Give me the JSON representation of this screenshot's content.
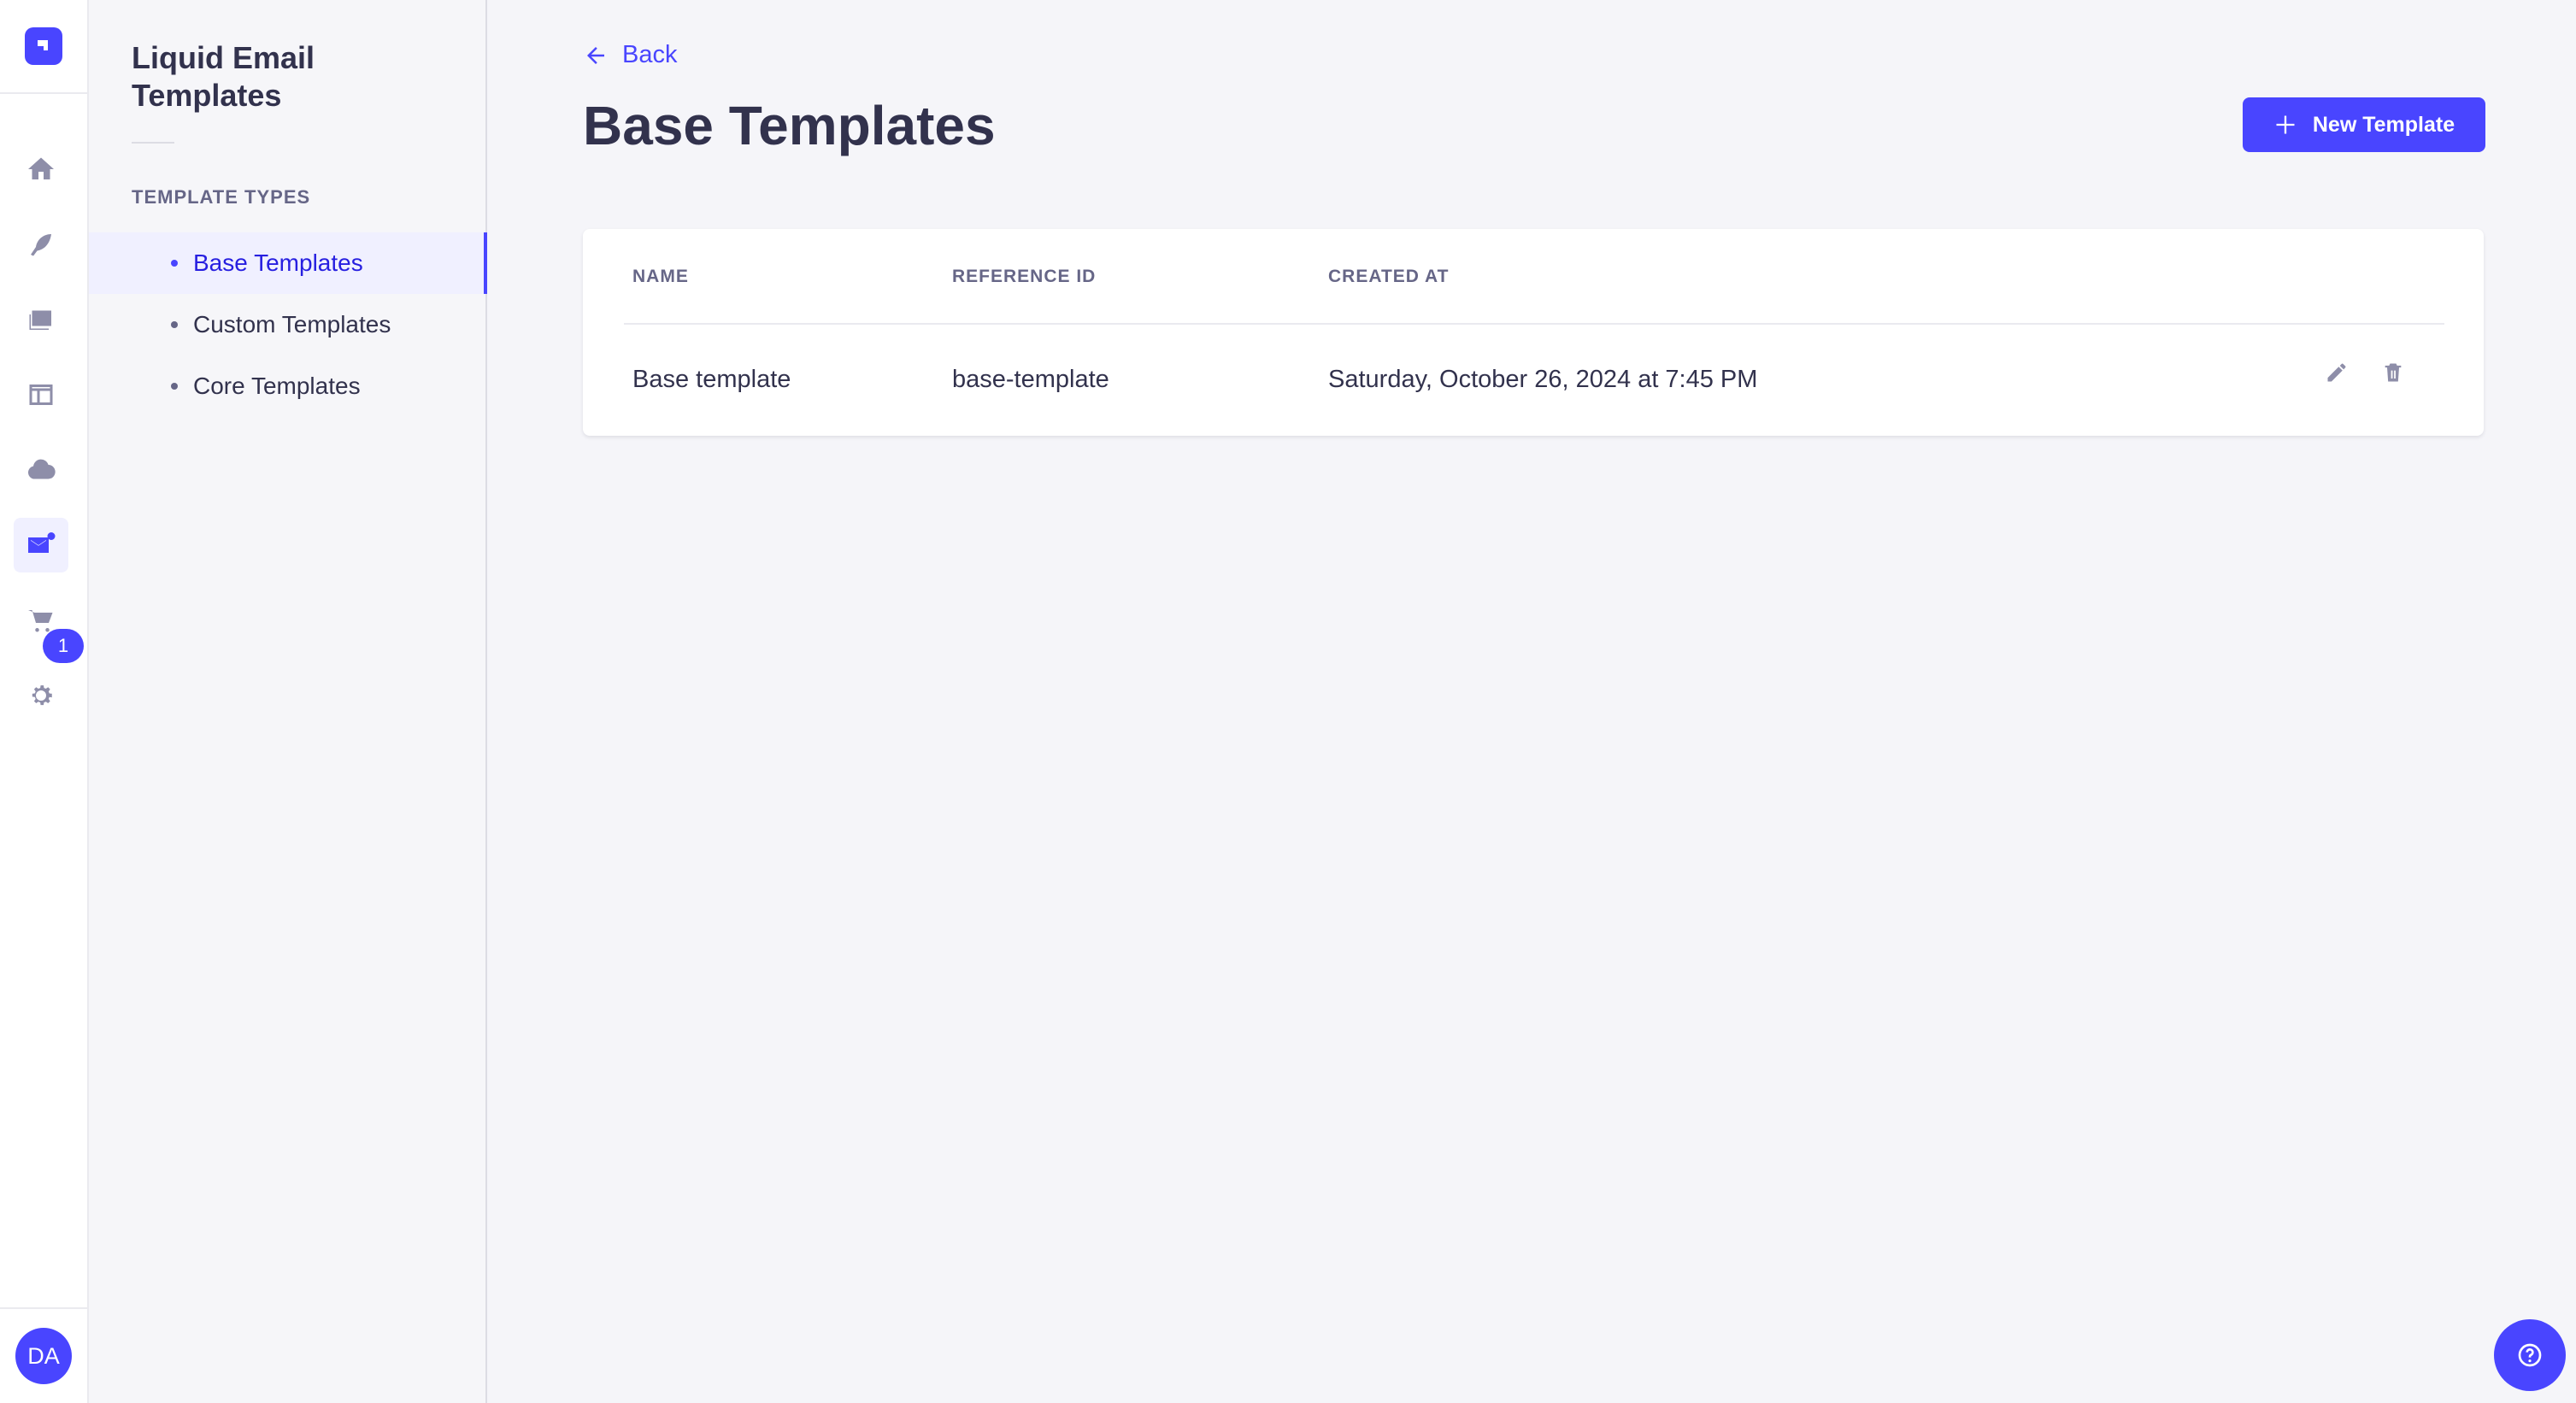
{
  "rail": {
    "items": [
      {
        "icon": "home-icon"
      },
      {
        "icon": "feather-icon"
      },
      {
        "icon": "media-library-icon"
      },
      {
        "icon": "layout-icon"
      },
      {
        "icon": "cloud-icon"
      },
      {
        "icon": "email-icon",
        "active": true
      },
      {
        "icon": "cart-icon"
      },
      {
        "icon": "settings-icon"
      }
    ],
    "settings_badge": "1",
    "user_initials": "DA"
  },
  "subnav": {
    "title": "Liquid Email Templates",
    "section_label": "TEMPLATE TYPES",
    "items": [
      {
        "label": "Base Templates",
        "active": true
      },
      {
        "label": "Custom Templates"
      },
      {
        "label": "Core Templates"
      }
    ]
  },
  "header": {
    "back_label": "Back",
    "title": "Base Templates",
    "new_button_label": "New Template"
  },
  "table": {
    "columns": [
      "NAME",
      "REFERENCE ID",
      "CREATED AT"
    ],
    "rows": [
      {
        "name": "Base template",
        "reference_id": "base-template",
        "created_at": "Saturday, October 26, 2024 at 7:45 PM"
      }
    ]
  },
  "colors": {
    "accent": "#4945ff",
    "background": "#f5f5f9",
    "text": "#32324d",
    "muted": "#666687"
  }
}
